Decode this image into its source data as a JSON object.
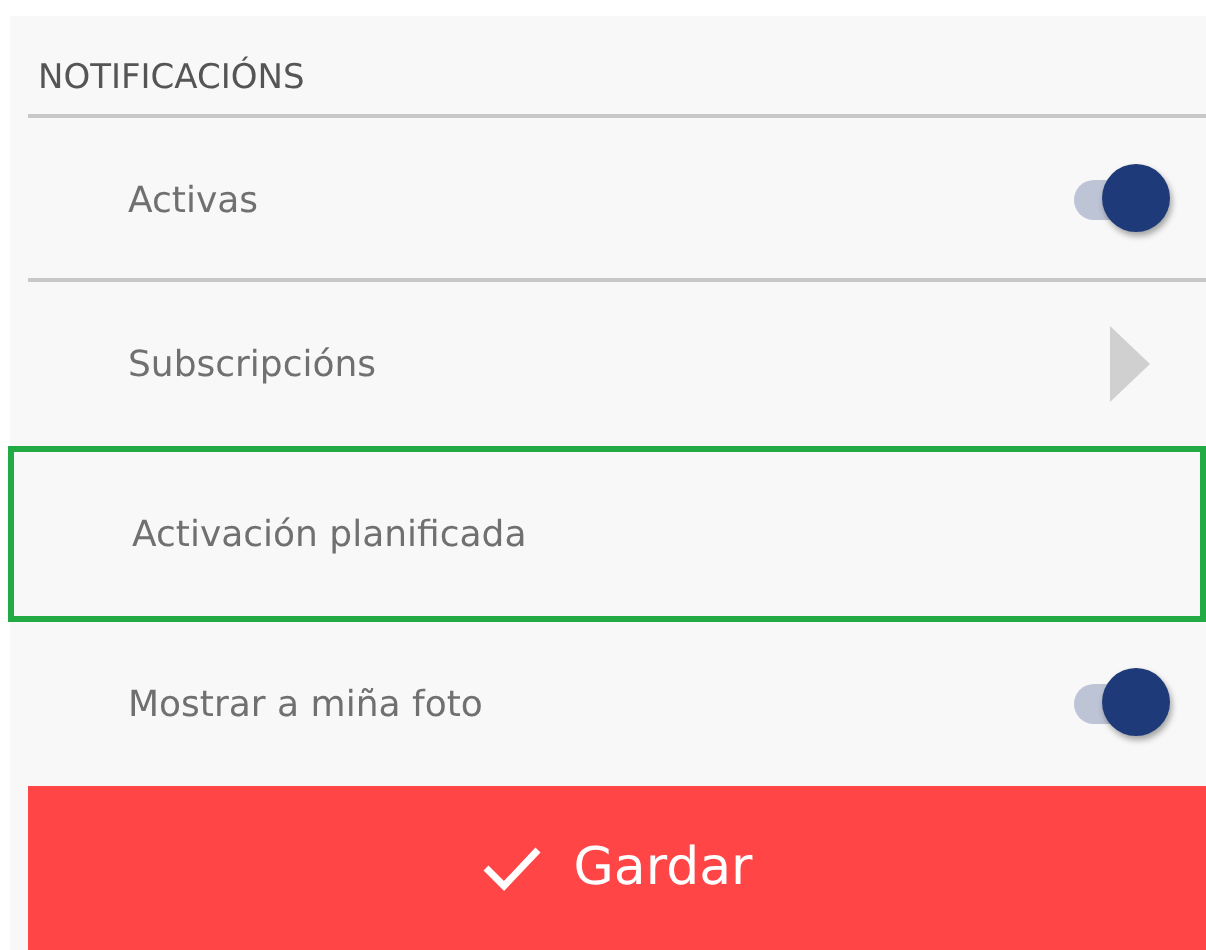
{
  "section": {
    "title": "NOTIFICACIÓNS"
  },
  "items": [
    {
      "kind": "toggle",
      "label": "Activas",
      "on": true,
      "highlighted": false
    },
    {
      "kind": "link",
      "label": "Subscripcións",
      "highlighted": false
    },
    {
      "kind": "plain",
      "label": "Activación planificada",
      "highlighted": true
    },
    {
      "kind": "toggle",
      "label": "Mostrar a miña foto",
      "on": true,
      "highlighted": false
    }
  ],
  "save_button": {
    "label": "Gardar"
  }
}
